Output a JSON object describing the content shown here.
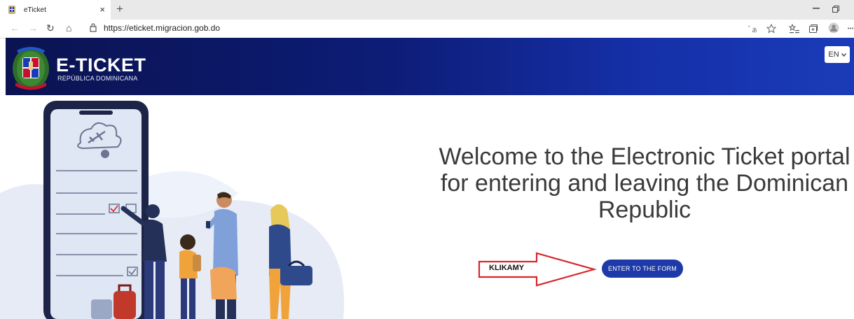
{
  "browser": {
    "tab_title": "eTicket",
    "tab_close": "×",
    "new_tab": "+",
    "url": "https://eticket.migracion.gob.do",
    "back": "←",
    "forward": "→",
    "refresh": "↻",
    "home": "⌂",
    "icons": [
      "translate-icon",
      "star-icon",
      "favorites-icon",
      "collections-icon",
      "profile-icon",
      "more-icon"
    ]
  },
  "header": {
    "brand": "E-TICKET",
    "subtitle": "REPÚBLICA DOMINICANA",
    "language": "EN"
  },
  "main": {
    "welcome_lines": [
      "Welcome to the Electronic Ticket portal",
      "for entering and leaving the Dominican",
      "Republic"
    ],
    "enter_button": "ENTER TO THE FORM"
  },
  "annotation": {
    "label": "KLIKAMY",
    "color": "#d9262b"
  },
  "colors": {
    "header_dark": "#0b1350",
    "header_light": "#1a3bb8",
    "button": "#1d3aa8"
  }
}
